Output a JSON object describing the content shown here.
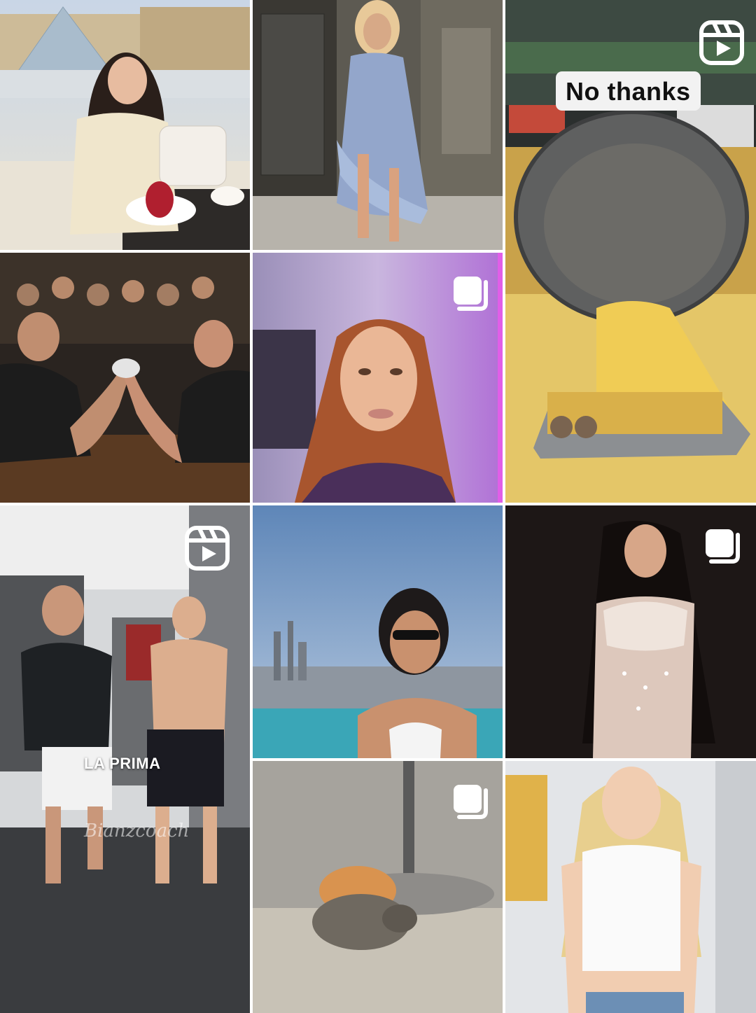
{
  "grid": {
    "tiles": [
      {
        "id": "t1",
        "kind": "photo",
        "scene": "woman seated at cafe table in front of glass pyramid with dessert and white handbag"
      },
      {
        "id": "t2",
        "kind": "photo",
        "scene": "blonde woman in light blue ruffled denim dress on sidewalk"
      },
      {
        "id": "t3",
        "kind": "reel",
        "scene": "pan pouring melted cheese over fries and potatoes",
        "caption": "No thanks"
      },
      {
        "id": "t4",
        "kind": "photo",
        "scene": "two muscular men arm wrestling in front of crowd"
      },
      {
        "id": "t5",
        "kind": "carousel",
        "scene": "woman with auburn hair selfie in purple lit room"
      },
      {
        "id": "t6",
        "kind": "reel",
        "scene": "two men standing in gym",
        "caption": "LA PRIMA",
        "watermark": "Bianzcoach"
      },
      {
        "id": "t7",
        "kind": "photo",
        "scene": "woman in sunglasses at rooftop infinity pool above city skyline"
      },
      {
        "id": "t8",
        "kind": "carousel",
        "scene": "woman in embellished white dress on dark background"
      },
      {
        "id": "t9",
        "kind": "carousel",
        "scene": "two kittens cuddling on sand near umbrella pole"
      },
      {
        "id": "t10",
        "kind": "photo",
        "scene": "blonde woman in white crop top"
      }
    ]
  },
  "icons": {
    "reel": "reels-icon",
    "carousel": "carousel-icon"
  },
  "colors": {
    "background": "#ffffff",
    "badge": "#ffffff"
  }
}
